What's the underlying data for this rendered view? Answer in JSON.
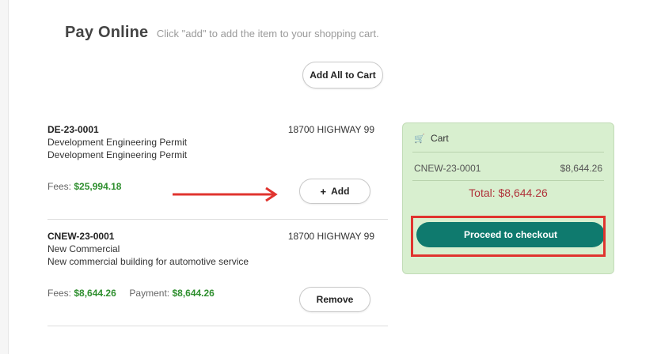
{
  "header": {
    "title": "Pay Online",
    "hint": "Click \"add\" to add the item to your shopping cart."
  },
  "toolbar": {
    "add_all_label": "Add All to Cart"
  },
  "items": [
    {
      "code": "DE-23-0001",
      "address": "18700 HIGHWAY 99",
      "line1": "Development Engineering Permit",
      "line2": "Development Engineering Permit",
      "fees_label": "Fees:",
      "fees_value": "$25,994.18",
      "button_label": "Add"
    },
    {
      "code": "CNEW-23-0001",
      "address": "18700 HIGHWAY 99",
      "line1": "New Commercial",
      "line2": "New commercial building for automotive service",
      "fees_label": "Fees:",
      "fees_value": "$8,644.26",
      "payment_label": "Payment:",
      "payment_value": "$8,644.26",
      "button_label": "Remove"
    }
  ],
  "cart": {
    "title": "Cart",
    "entries": [
      {
        "code": "CNEW-23-0001",
        "amount": "$8,644.26"
      }
    ],
    "total": "Total: $8,644.26",
    "checkout_label": "Proceed to checkout"
  },
  "icons": {
    "cart": "shopping-cart-icon",
    "add": "plus-icon",
    "annotation_arrow": "red-arrow",
    "annotation_box": "red-highlight-box"
  },
  "colors": {
    "accent": "#0f7a6e",
    "money_green": "#2f8f2f",
    "total_red": "#b0333b",
    "cart_bg": "#d8efcf",
    "annotation_red": "#e0342f"
  }
}
